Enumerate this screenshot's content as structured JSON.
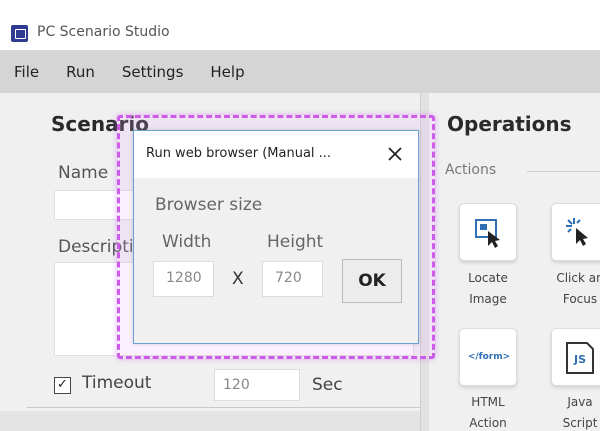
{
  "app": {
    "title": "PC Scenario Studio",
    "icon": "app-logo-icon"
  },
  "menu": [
    "File",
    "Run",
    "Settings",
    "Help"
  ],
  "scenario": {
    "title": "Scenario",
    "name_label": "Name",
    "description_label": "Description",
    "timeout_checked": true,
    "timeout_label": "Timeout",
    "timeout_value": "120",
    "timeout_unit": "Sec"
  },
  "operations": {
    "title": "Operations",
    "actions_label": "Actions",
    "tiles": [
      {
        "icon": "locate-image-icon",
        "label_lines": [
          "Locate",
          "Image"
        ]
      },
      {
        "icon": "click-focus-icon",
        "label_lines": [
          "Click an",
          "Focus"
        ]
      },
      {
        "icon": "html-form-icon",
        "icon_text": "</form>",
        "label_lines": [
          "HTML",
          "Action"
        ]
      },
      {
        "icon": "javascript-icon",
        "icon_text": "JS",
        "label_lines": [
          "Java",
          "Script"
        ]
      }
    ]
  },
  "dialog": {
    "title": "Run web browser (Manual ...",
    "section_label": "Browser size",
    "width_label": "Width",
    "height_label": "Height",
    "width_value": "1280",
    "separator": "X",
    "height_value": "720",
    "ok_label": "OK"
  },
  "colors": {
    "menubar_bg": "#d5d5d5",
    "highlight_outline": "#cc5ce8",
    "dialog_border": "#6aa0d4"
  }
}
